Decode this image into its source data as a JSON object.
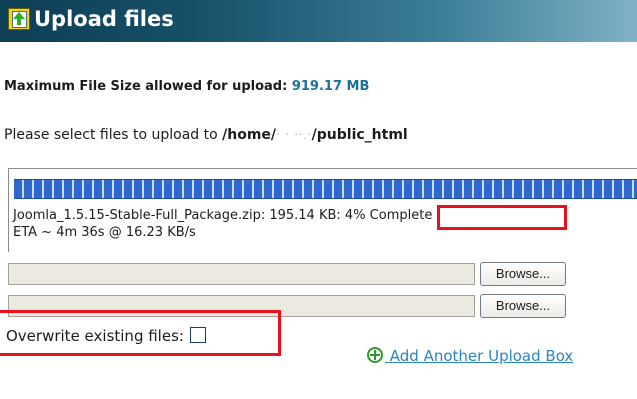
{
  "header": {
    "title": "Upload files",
    "icon": "upload-file-icon"
  },
  "limits": {
    "max_label": "Maximum File Size allowed for upload:",
    "max_value": "919.17 MB"
  },
  "destination": {
    "prompt": "Please select files to upload to",
    "path_start": "/home/",
    "path_redacted": "·  ·  ··.·",
    "path_end": "/public_html"
  },
  "progress": {
    "filename_size": "Joomla_1.5.15-Stable-Full_Package.zip: 195.14 KB:",
    "percent_text": "4% Complete",
    "percent": 4,
    "eta": "ETA ~ 4m 36s @ 16.23 KB/s",
    "bar_color": "#3168cf"
  },
  "uploads": {
    "browse_label": "Browse...",
    "field_values": [
      "",
      ""
    ]
  },
  "options": {
    "overwrite_label": "Overwrite existing files:",
    "overwrite_checked": false
  },
  "actions": {
    "add_box_label": "Add Another Upload Box",
    "add_icon": "add-circle-icon"
  },
  "colors": {
    "title_bg": "#164f68",
    "highlight": "#e8121f",
    "link": "#2b86bd",
    "size_value": "#1e6f99"
  }
}
